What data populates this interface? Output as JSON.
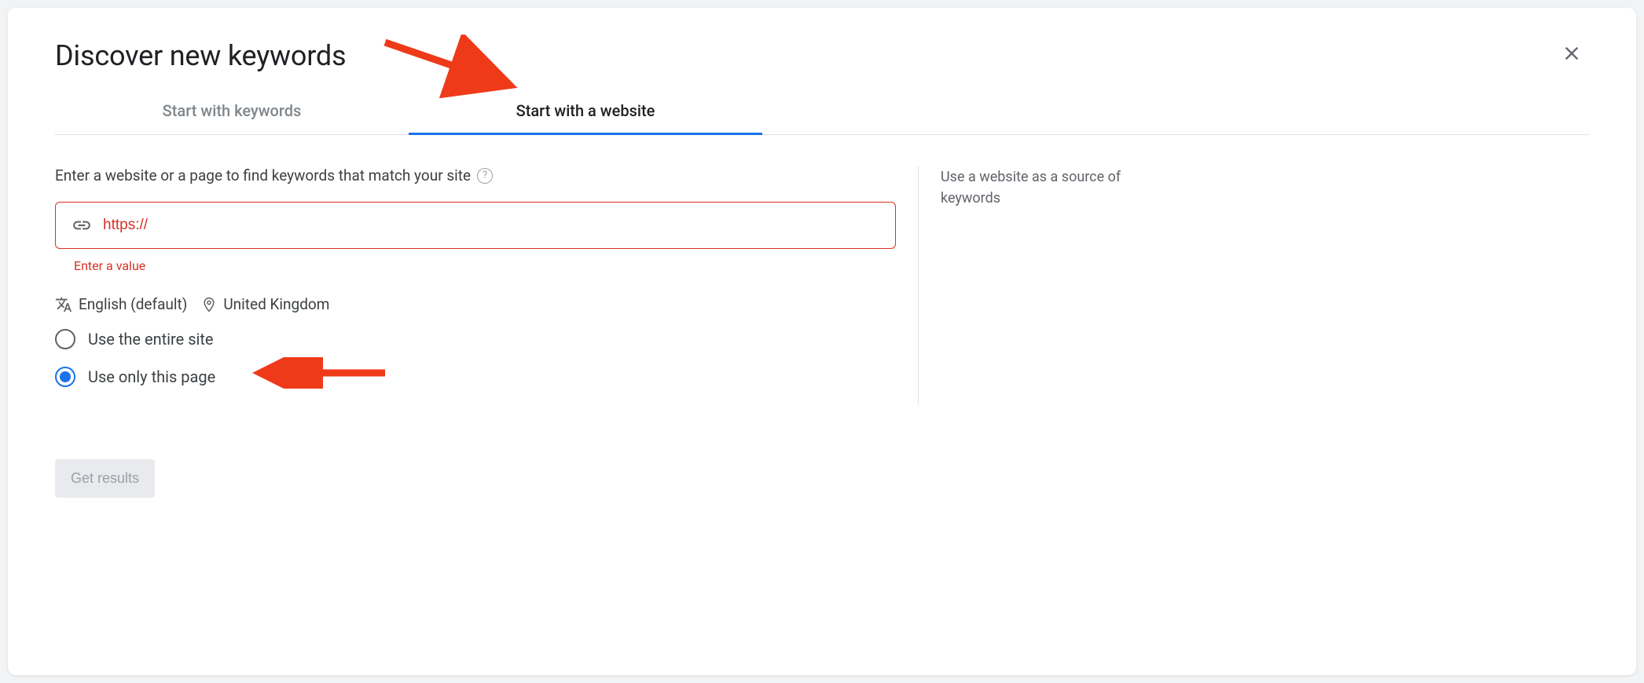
{
  "header": {
    "title": "Discover new keywords"
  },
  "tabs": {
    "keywords": "Start with keywords",
    "website": "Start with a website"
  },
  "form": {
    "label": "Enter a website or a page to find keywords that match your site",
    "url_value": "https://",
    "error": "Enter a value",
    "language": "English (default)",
    "location": "United Kingdom"
  },
  "radios": {
    "entire_site": "Use the entire site",
    "only_page": "Use only this page"
  },
  "sidebar": {
    "hint": "Use a website as a source of keywords"
  },
  "actions": {
    "get_results": "Get results"
  }
}
